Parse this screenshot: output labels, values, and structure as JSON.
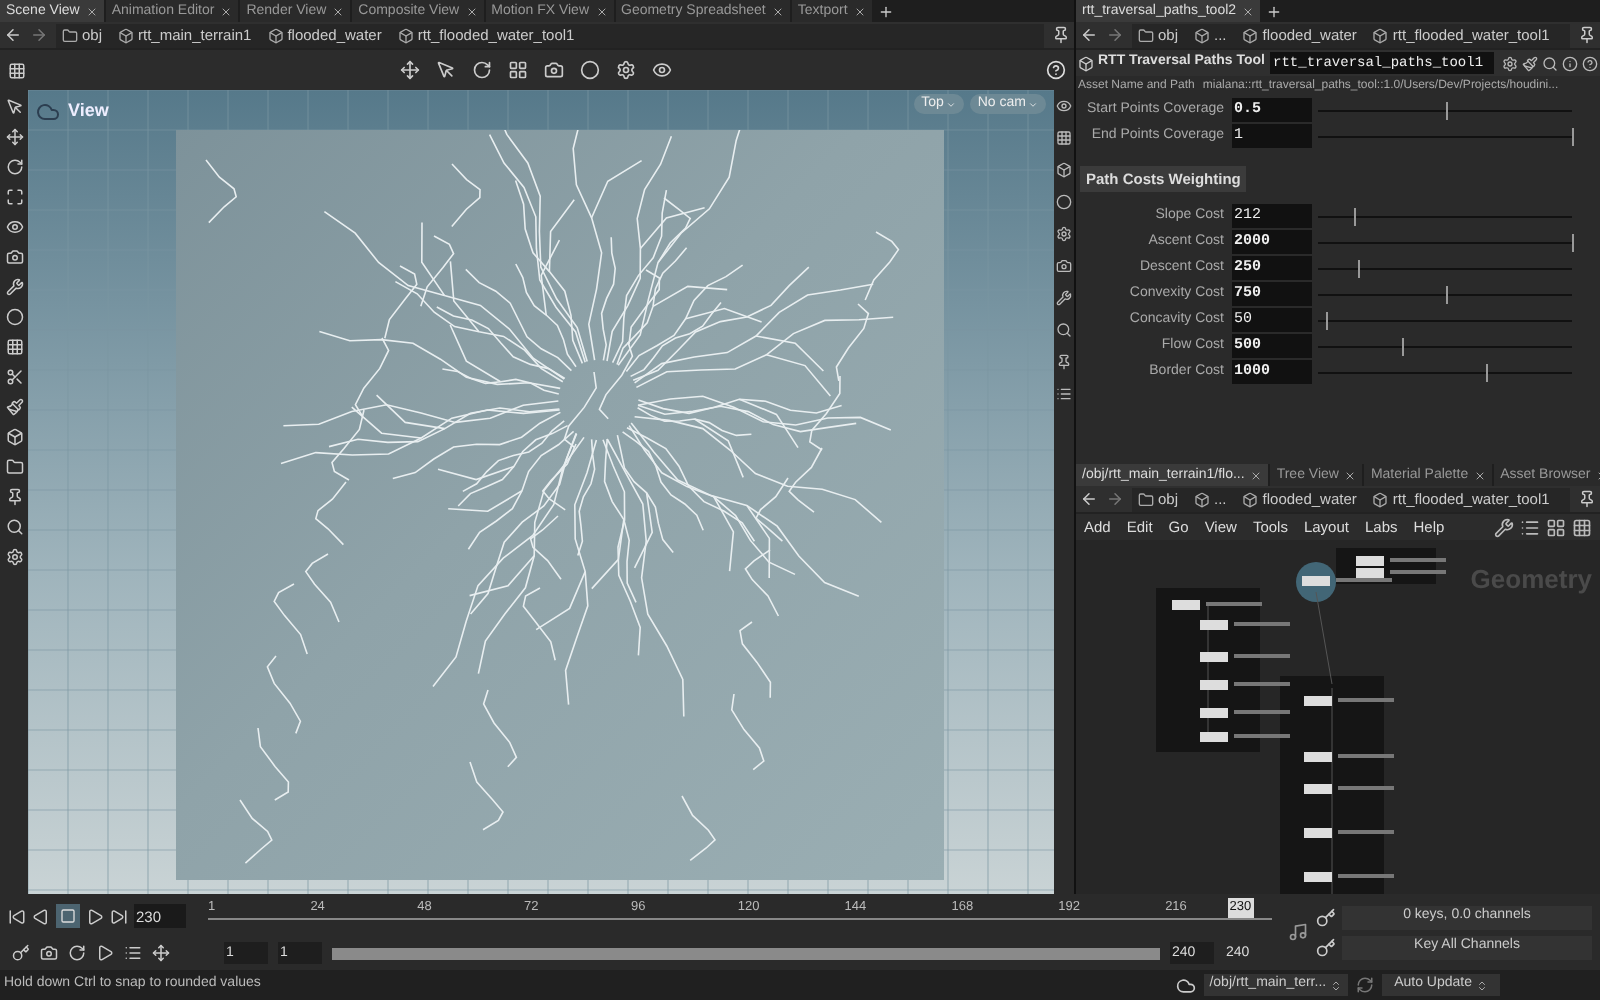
{
  "scene_pane": {
    "tabs": [
      {
        "label": "Scene View",
        "selected": true
      },
      {
        "label": "Animation Editor",
        "selected": false
      },
      {
        "label": "Render View",
        "selected": false
      },
      {
        "label": "Composite View",
        "selected": false
      },
      {
        "label": "Motion FX View",
        "selected": false
      },
      {
        "label": "Geometry Spreadsheet",
        "selected": false
      },
      {
        "label": "Textport",
        "selected": false
      }
    ],
    "path": [
      "obj",
      "rtt_main_terrain1",
      "flooded_water",
      "rtt_flooded_water_tool1"
    ],
    "viewport": {
      "title": "View",
      "view_menu": "Top",
      "camera_menu": "No cam"
    }
  },
  "parameter_pane": {
    "tabs": [
      {
        "label": "rtt_traversal_paths_tool2",
        "selected": true
      }
    ],
    "path": [
      "obj",
      "...",
      "flooded_water",
      "rtt_flooded_water_tool1"
    ],
    "node_type": "RTT Traversal Paths Tool",
    "node_name": "rtt_traversal_paths_tool1",
    "asset_label": "Asset Name and Path",
    "asset_value": "mialana::rtt_traversal_paths_tool::1.0/Users/Dev/Projects/houdini...",
    "parameters": [
      {
        "kind": "param",
        "label": "Start Points Coverage",
        "value": "0.5",
        "level": 0.5
      },
      {
        "kind": "param",
        "label": "End Points Coverage",
        "value": "1",
        "level": 1
      },
      {
        "kind": "section",
        "label": "Path Costs Weighting"
      },
      {
        "kind": "param",
        "label": "Slope Cost",
        "value": "212",
        "level": 0.14
      },
      {
        "kind": "param",
        "label": "Ascent Cost",
        "value": "2000",
        "level": 1
      },
      {
        "kind": "param",
        "label": "Descent Cost",
        "value": "250",
        "level": 0.16
      },
      {
        "kind": "param",
        "label": "Convexity Cost",
        "value": "750",
        "level": 0.5
      },
      {
        "kind": "param",
        "label": "Concavity Cost",
        "value": "50",
        "level": 0.03
      },
      {
        "kind": "param",
        "label": "Flow Cost",
        "value": "500",
        "level": 0.33
      },
      {
        "kind": "param",
        "label": "Border Cost",
        "value": "1000",
        "level": 0.66
      }
    ]
  },
  "network_pane": {
    "tabs": [
      {
        "label": "/obj/rtt_main_terrain1/flo...",
        "selected": true
      },
      {
        "label": "Tree View",
        "selected": false
      },
      {
        "label": "Material Palette",
        "selected": false
      },
      {
        "label": "Asset Browser",
        "selected": false
      }
    ],
    "path": [
      "obj",
      "...",
      "flooded_water",
      "rtt_flooded_water_tool1"
    ],
    "menu": [
      "Add",
      "Edit",
      "Go",
      "View",
      "Tools",
      "Layout",
      "Labs",
      "Help"
    ],
    "context_label": "Geometry"
  },
  "timeline": {
    "current_frame": "230",
    "ticks": [
      "1",
      "24",
      "48",
      "72",
      "96",
      "120",
      "144",
      "168",
      "192",
      "216"
    ],
    "marker": "230",
    "start": "1",
    "start_2": "1",
    "end": "240",
    "end_2": "240"
  },
  "keys_panel": {
    "keys": "0 keys, 0.0 channels",
    "key_mode": "Key All Channels"
  },
  "status_bar": {
    "message": "Hold down Ctrl to snap to rounded values",
    "network_path": "/obj/rtt_main_terr...",
    "update_mode": "Auto Update"
  }
}
